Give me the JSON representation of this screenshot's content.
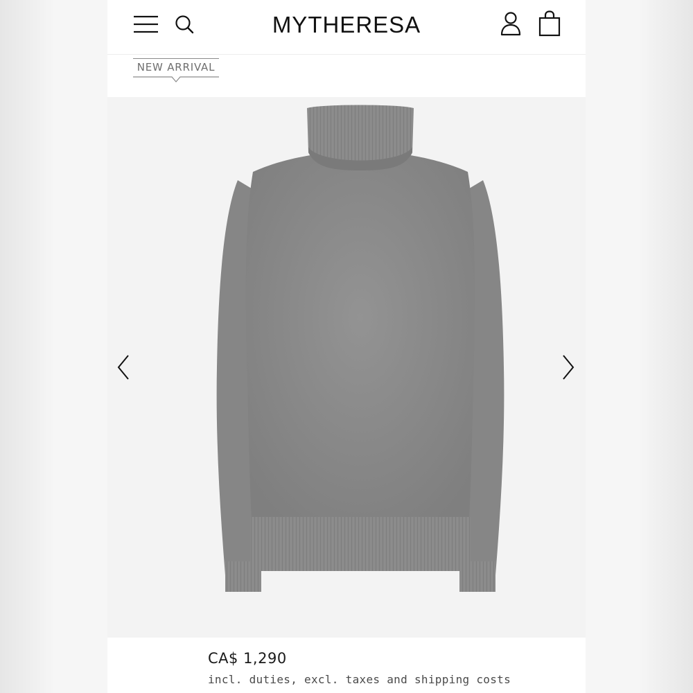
{
  "header": {
    "logo_text": "MYTHERESA",
    "icons": {
      "menu": "hamburger-menu-icon",
      "search": "search-icon",
      "account": "user-icon",
      "bag": "shopping-bag-icon"
    }
  },
  "product": {
    "badge": "NEW ARRIVAL",
    "image_description": "grey turtleneck sweater",
    "price": "CA$ 1,290",
    "price_note": "incl. duties, excl. taxes and shipping costs"
  },
  "gallery": {
    "prev_icon": "chevron-left-icon",
    "next_icon": "chevron-right-icon"
  },
  "colors": {
    "sweater": "#8a8a8a",
    "text": "#111111",
    "muted": "#6e6e6e"
  }
}
